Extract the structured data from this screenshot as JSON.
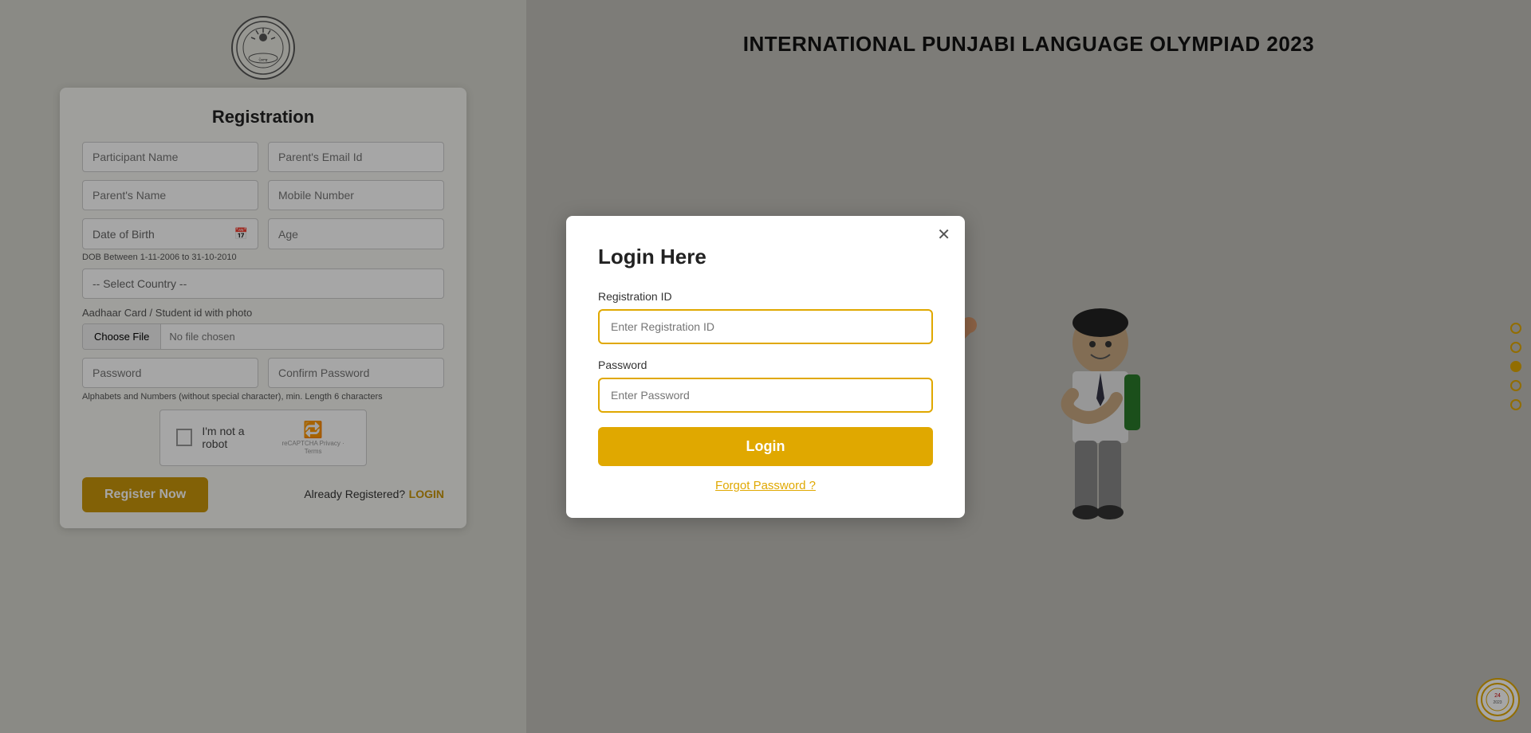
{
  "logo": {
    "alt": "Institution Logo"
  },
  "registration": {
    "title": "Registration",
    "fields": {
      "participant_name": {
        "placeholder": "Participant Name"
      },
      "parents_email": {
        "placeholder": "Parent's Email Id"
      },
      "parents_name": {
        "placeholder": "Parent's Name"
      },
      "mobile_number": {
        "placeholder": "Mobile Number"
      },
      "date_of_birth": {
        "placeholder": "Date of Birth"
      },
      "age": {
        "placeholder": "Age"
      },
      "dob_hint": "DOB Between 1-11-2006 to 31-10-2010",
      "country": {
        "placeholder": "-- Select Country --"
      },
      "aadhaar_label": "Aadhaar Card / Student id with photo",
      "choose_file": "Choose File",
      "no_file": "No file chosen",
      "password": {
        "placeholder": "Password"
      },
      "confirm_password": {
        "placeholder": "Confirm Password"
      },
      "password_hint": "Alphabets and Numbers (without special character), min. Length 6 characters",
      "captcha_label": "I'm not a robot",
      "captcha_sub": "reCAPTCHA\nPrivacy · Terms"
    },
    "register_btn": "Register Now",
    "already_text": "Already Registered?",
    "login_link": "LOGIN"
  },
  "right_panel": {
    "title": "INTERNATIONAL PUNJABI LANGUAGE OLYMPIAD 2023"
  },
  "dots": [
    {
      "active": false
    },
    {
      "active": false
    },
    {
      "active": true
    },
    {
      "active": false
    },
    {
      "active": false
    }
  ],
  "modal": {
    "title": "Login Here",
    "reg_id_label": "Registration ID",
    "reg_id_placeholder": "Enter Registration ID",
    "password_label": "Password",
    "password_placeholder": "Enter Password",
    "login_btn": "Login",
    "forgot_password": "Forgot Password ?"
  }
}
